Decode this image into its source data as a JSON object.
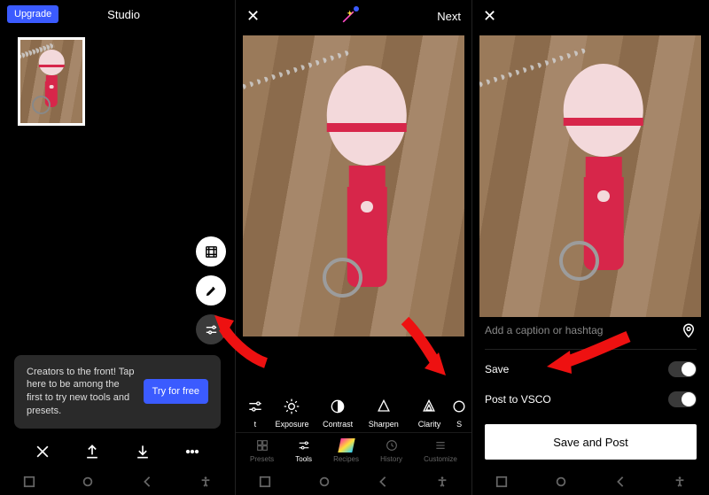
{
  "panel1": {
    "upgrade": "Upgrade",
    "title": "Studio",
    "promo_text": "Creators to the front! Tap here to be among the first to try new tools and presets.",
    "try_free": "Try for free"
  },
  "panel2": {
    "next": "Next",
    "tools": [
      {
        "label": "t"
      },
      {
        "label": "Exposure"
      },
      {
        "label": "Contrast"
      },
      {
        "label": "Sharpen"
      },
      {
        "label": "Clarity"
      },
      {
        "label": "S"
      }
    ],
    "tabs": [
      {
        "label": "Presets"
      },
      {
        "label": "Tools"
      },
      {
        "label": "Recipes"
      },
      {
        "label": "History"
      },
      {
        "label": "Customize"
      }
    ]
  },
  "panel3": {
    "caption_placeholder": "Add a caption or hashtag",
    "save": "Save",
    "post_vsco": "Post to VSCO",
    "save_post": "Save and Post"
  }
}
